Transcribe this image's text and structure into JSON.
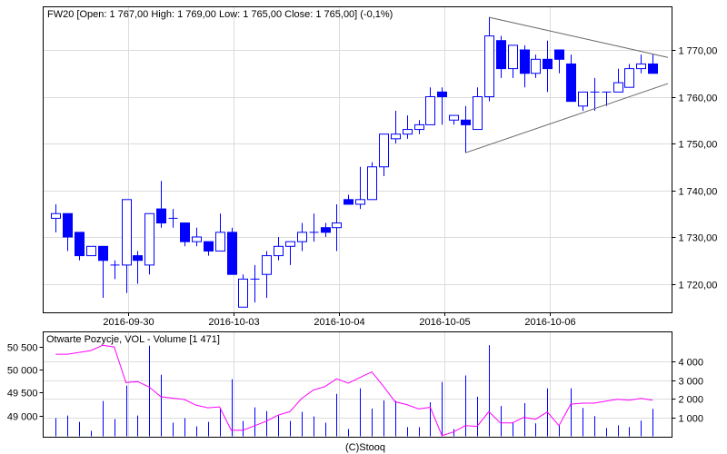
{
  "title": "FW20 [Open: 1 767,00  High: 1 769,00  Low: 1 765,00  Close: 1 765,00] (-0,1%)",
  "volume_title": "Otwarte Pozycje, VOL - Volume [1 471]",
  "copyright": "(C)Stooq",
  "colors": {
    "candle": "#0000ff",
    "oi_line": "#ff00ff",
    "volume": "#0000ff",
    "trend": "#666666",
    "grid": "#dcdcdc"
  },
  "chart_data": [
    {
      "type": "candlestick",
      "title": "FW20",
      "ylim": [
        1713,
        1779
      ],
      "yticks": [
        1720,
        1730,
        1740,
        1750,
        1760,
        1770
      ],
      "ytick_labels": [
        "1 720,00",
        "1 730,00",
        "1 740,00",
        "1 750,00",
        "1 760,00",
        "1 770,00"
      ],
      "xtick_index": [
        7,
        16,
        25,
        34,
        43
      ],
      "xtick_labels": [
        "2016-09-30",
        "2016-10-03",
        "2016-10-04",
        "2016-10-05",
        "2016-10-06"
      ],
      "grid": true,
      "ohlc": [
        [
          1734,
          1737,
          1731,
          1735
        ],
        [
          1735,
          1735,
          1727,
          1730
        ],
        [
          1731,
          1731,
          1725,
          1726
        ],
        [
          1726,
          1728,
          1726,
          1728
        ],
        [
          1728,
          1728,
          1717,
          1725
        ],
        [
          1724,
          1725,
          1721,
          1724
        ],
        [
          1724,
          1738,
          1718,
          1738
        ],
        [
          1726,
          1727,
          1720,
          1725
        ],
        [
          1724,
          1735,
          1722,
          1735
        ],
        [
          1736,
          1742,
          1732,
          1733
        ],
        [
          1734,
          1736,
          1732,
          1734
        ],
        [
          1733,
          1733,
          1728,
          1729
        ],
        [
          1729,
          1732,
          1728,
          1730
        ],
        [
          1729,
          1729,
          1726,
          1727
        ],
        [
          1727,
          1735,
          1727,
          1731
        ],
        [
          1731,
          1732,
          1722,
          1722
        ],
        [
          1715,
          1722,
          1715,
          1721
        ],
        [
          1721,
          1724,
          1716,
          1721
        ],
        [
          1722,
          1727,
          1717,
          1726
        ],
        [
          1726,
          1730,
          1725,
          1728
        ],
        [
          1728,
          1729,
          1724,
          1729
        ],
        [
          1729,
          1733,
          1727,
          1731
        ],
        [
          1731,
          1735,
          1729,
          1731
        ],
        [
          1732,
          1733,
          1730,
          1731
        ],
        [
          1732,
          1737,
          1727,
          1733
        ],
        [
          1738,
          1739,
          1737,
          1737
        ],
        [
          1737,
          1745,
          1736,
          1738
        ],
        [
          1738,
          1746,
          1738,
          1745
        ],
        [
          1745,
          1752,
          1743,
          1752
        ],
        [
          1751,
          1757,
          1750,
          1752
        ],
        [
          1752,
          1756,
          1751,
          1753
        ],
        [
          1753,
          1755,
          1752,
          1754
        ],
        [
          1754,
          1762,
          1754,
          1760
        ],
        [
          1761,
          1762,
          1754,
          1760
        ],
        [
          1755,
          1756,
          1754,
          1756
        ],
        [
          1755,
          1758,
          1748,
          1754
        ],
        [
          1753,
          1762,
          1753,
          1760
        ],
        [
          1760,
          1777,
          1759,
          1773
        ],
        [
          1772,
          1773,
          1764,
          1766
        ],
        [
          1766,
          1771,
          1764,
          1771
        ],
        [
          1770,
          1771,
          1762,
          1765
        ],
        [
          1765,
          1769,
          1764,
          1768
        ],
        [
          1768,
          1772,
          1761,
          1766
        ],
        [
          1770,
          1770,
          1765,
          1768
        ],
        [
          1767,
          1769,
          1759,
          1759
        ],
        [
          1758,
          1761,
          1757,
          1761
        ],
        [
          1761,
          1764,
          1757,
          1761
        ],
        [
          1761,
          1761,
          1758,
          1761
        ],
        [
          1761,
          1766,
          1761,
          1763
        ],
        [
          1762,
          1767,
          1762,
          1766
        ],
        [
          1766,
          1769,
          1765,
          1767
        ],
        [
          1767,
          1769,
          1765,
          1765
        ]
      ],
      "trendlines": [
        {
          "from": [
            37,
            1777
          ],
          "to": [
            52.3,
            1768.4
          ]
        },
        {
          "from": [
            35,
            1748
          ],
          "to": [
            52.3,
            1762.8
          ]
        }
      ]
    },
    {
      "type": "bar+line",
      "title": "Otwarte Pozycje, VOL - Volume [1 471]",
      "volume_ylim": [
        0,
        5600
      ],
      "volume_ticks": [
        1000,
        2000,
        3000,
        4000
      ],
      "volume_tick_labels": [
        "1 000",
        "2 000",
        "3 000",
        "4 000"
      ],
      "oi_ylim": [
        48560,
        50690
      ],
      "oi_ticks": [
        49000,
        49500,
        50000,
        50500
      ],
      "oi_tick_labels": [
        "49 000",
        "49 500",
        "50 000",
        "50 500"
      ],
      "volume": [
        970,
        1110,
        770,
        290,
        1890,
        920,
        2710,
        1110,
        4840,
        3290,
        730,
        970,
        530,
        770,
        1520,
        3050,
        820,
        1550,
        1350,
        1110,
        820,
        1310,
        1060,
        730,
        2270,
        390,
        2560,
        1480,
        1920,
        1900,
        490,
        490,
        1820,
        2900,
        390,
        3250,
        2110,
        4870,
        1620,
        740,
        1770,
        690,
        2560,
        590,
        2560,
        1520,
        1080,
        440,
        590,
        490,
        840,
        1471
      ],
      "open_interest": [
        50335,
        50335,
        50375,
        50415,
        50530,
        50495,
        49720,
        49740,
        49620,
        49410,
        49380,
        49350,
        49225,
        49170,
        49190,
        48680,
        48680,
        48780,
        48880,
        49010,
        49085,
        49370,
        49555,
        49630,
        49800,
        49705,
        49830,
        49950,
        49640,
        49300,
        49240,
        49145,
        49180,
        48565,
        48645,
        48780,
        48765,
        49085,
        48840,
        48840,
        48960,
        48920,
        49080,
        48780,
        49250,
        49270,
        49270,
        49315,
        49355,
        49335,
        49375,
        49335
      ]
    }
  ]
}
